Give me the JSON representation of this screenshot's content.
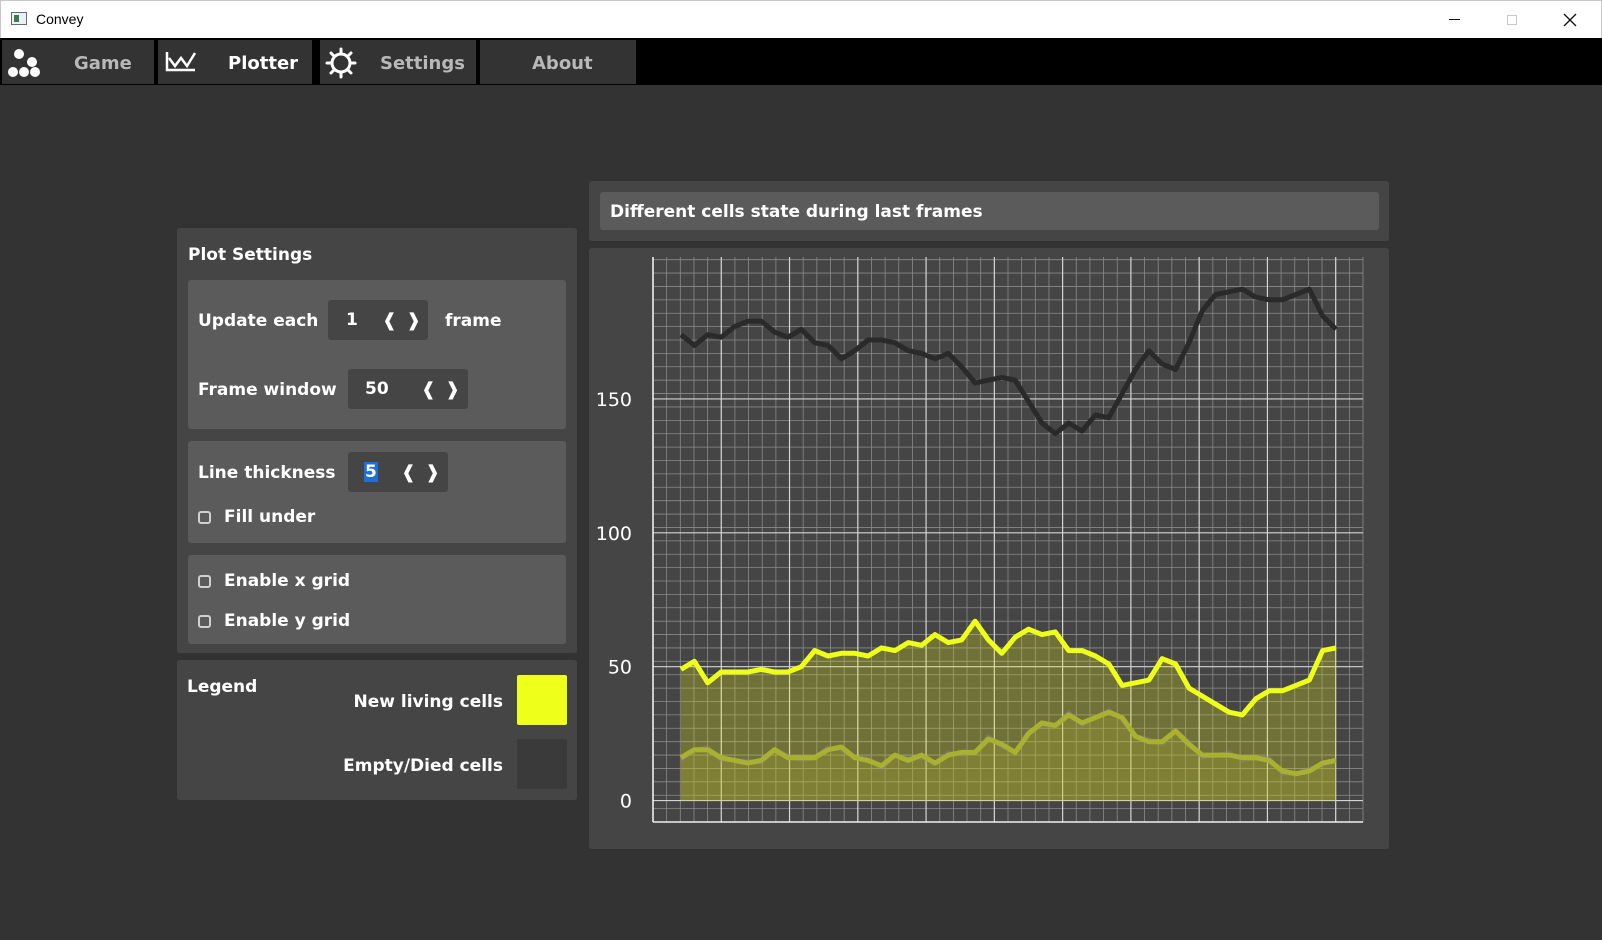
{
  "window": {
    "title": "Convey"
  },
  "tabs": [
    {
      "label": "Game",
      "icon": "cells-icon",
      "active": false
    },
    {
      "label": "Plotter",
      "icon": "chart-icon",
      "active": true
    },
    {
      "label": "Settings",
      "icon": "gear-icon",
      "active": false
    },
    {
      "label": "About",
      "icon": "",
      "active": false
    }
  ],
  "plot_settings": {
    "title": "Plot Settings",
    "update_each_label": "Update each",
    "update_each_value": "1",
    "update_each_suffix": "frame",
    "frame_window_label": "Frame window",
    "frame_window_value": "50",
    "line_thickness_label": "Line thickness",
    "line_thickness_value": "5",
    "fill_under_label": "Fill under",
    "fill_under_checked": false,
    "x_grid_label": "Enable x grid",
    "x_grid_checked": false,
    "y_grid_label": "Enable y grid",
    "y_grid_checked": false
  },
  "legend": {
    "title": "Legend",
    "items": [
      {
        "label": "New living cells",
        "color": "#eeff1a"
      },
      {
        "label": "Empty/Died cells",
        "color": "#3a3a3a"
      }
    ]
  },
  "chart_data": {
    "type": "area",
    "title": "Different cells state during last frames",
    "ylim": [
      -8,
      203
    ],
    "xlim": [
      0,
      50
    ],
    "y_ticks": [
      0,
      50,
      100,
      150
    ],
    "grid": true,
    "colors": {
      "new_living": "#eeff1a",
      "empty_died": "#2a2a2a",
      "third": "#aab030"
    },
    "series": [
      {
        "values": [
          174,
          170,
          174,
          173,
          177,
          179,
          179,
          175,
          173,
          176,
          171,
          170,
          165,
          168,
          172,
          172,
          171,
          168,
          167,
          165,
          167,
          162,
          156,
          157,
          158,
          157,
          149,
          141,
          137,
          141,
          138,
          144,
          143,
          152,
          161,
          168,
          163,
          161,
          171,
          183,
          189,
          190,
          191,
          188,
          187,
          187,
          189,
          191,
          181,
          176
        ]
      },
      {
        "values": [
          49,
          52,
          44,
          48,
          48,
          48,
          49,
          48,
          48,
          50,
          56,
          54,
          55,
          55,
          54,
          57,
          56,
          59,
          58,
          62,
          59,
          60,
          67,
          60,
          55,
          61,
          64,
          62,
          63,
          56,
          56,
          54,
          51,
          43,
          44,
          45,
          53,
          51,
          42,
          39,
          36,
          33,
          32,
          38,
          41,
          41,
          43,
          45,
          56,
          57
        ]
      },
      {
        "values": [
          16,
          19,
          19,
          16,
          15,
          14,
          15,
          19,
          16,
          16,
          16,
          19,
          20,
          16,
          15,
          13,
          17,
          15,
          17,
          14,
          17,
          18,
          18,
          23,
          21,
          18,
          25,
          29,
          28,
          32,
          29,
          31,
          33,
          31,
          24,
          22,
          22,
          26,
          21,
          17,
          17,
          17,
          16,
          16,
          15,
          11,
          10,
          11,
          14,
          15
        ]
      }
    ]
  }
}
